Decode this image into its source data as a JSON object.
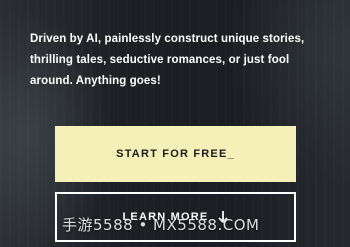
{
  "hero": {
    "tagline": "Driven by AI, painlessly construct unique stories, thrilling tales, seductive romances, or just fool around. Anything goes!",
    "start_button_label": "START FOR FREE_",
    "learn_more_label": "LEARN MORE",
    "learn_more_icon": "arrow-down-icon"
  },
  "watermark": {
    "text": "手游5588 • MX5588.COM"
  },
  "colors": {
    "start_button_bg": "#f4f0b8",
    "text_primary": "#ffffff"
  }
}
